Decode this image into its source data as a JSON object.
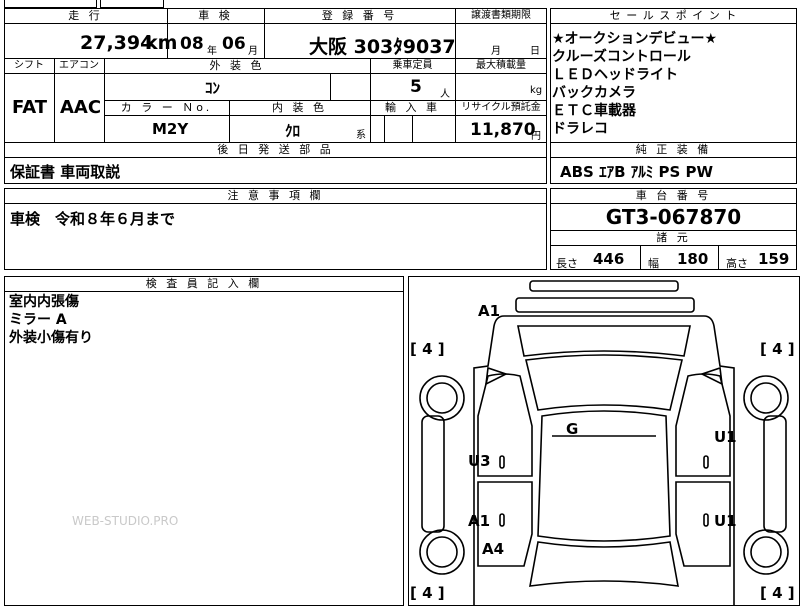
{
  "top": {
    "h_mileage": "走 行",
    "h_inspection": "車 検",
    "h_registration": "登 録 番 号",
    "h_transfer_deadline": "譲渡書類期限",
    "mileage_value": "27,394",
    "mileage_unit": "km",
    "inspection_year": "08",
    "inspection_year_unit": "年",
    "inspection_month": "06",
    "inspection_month_unit": "月",
    "registration": "大阪 303ﾀ9037",
    "transfer_month_unit": "月",
    "transfer_day_unit": "日"
  },
  "specs": {
    "h_shift": "シフト",
    "h_aircon": "エアコン",
    "h_exterior_color": "外 装 色",
    "h_capacity": "乗車定員",
    "h_max_load": "最大積載量",
    "shift": "FAT",
    "aircon": "AAC",
    "exterior_color": "ｺﾝ",
    "capacity": "5",
    "capacity_unit": "人",
    "max_load_unit": "kg",
    "h_color_no": "カ ラ ー Ｎo.",
    "h_interior_color": "内 装 色",
    "h_import": "輸 入 車",
    "h_recycle": "リサイクル預託金",
    "color_no": "M2Y",
    "interior_color": "ｸﾛ",
    "interior_suffix": "系",
    "recycle_fee": "11,870",
    "recycle_unit": "円"
  },
  "later_parts": {
    "header": "後 日 発 送 部 品",
    "value": "保証書 車両取説"
  },
  "notes": {
    "header": "注 意 事 項 欄",
    "value": "車検　令和８年６月まで"
  },
  "inspector": {
    "header": "検 査 員 記 入 欄",
    "lines": [
      "室内内張傷",
      "ミラー A",
      "外装小傷有り"
    ]
  },
  "sales_points": {
    "header": "セ ー ル ス ポ イ ン ト",
    "items": [
      "★オークションデビュー★",
      "クルーズコントロール",
      "ＬＥＤヘッドライト",
      "バックカメラ",
      "ＥＴＣ車載器",
      "ドラレコ"
    ]
  },
  "genuine_equipment": {
    "header": "純 正 装 備",
    "value": "ABS ｴｱB ｱﾙﾐ PS PW"
  },
  "chassis": {
    "header": "車 台 番 号",
    "value": "GT3-067870"
  },
  "dimensions": {
    "header": "諸 元",
    "length_label": "長さ",
    "length": "446",
    "width_label": "幅",
    "width": "180",
    "height_label": "高さ",
    "height": "159"
  },
  "diagram": {
    "marks": [
      "A1",
      "G",
      "U1",
      "U3",
      "A1",
      "U1",
      "A4"
    ],
    "tire_labels": [
      "[ 4 ]",
      "[ 4 ]",
      "[ 4 ]",
      "[ 4 ]"
    ]
  },
  "watermark": "WEB-STUDIO.PRO"
}
